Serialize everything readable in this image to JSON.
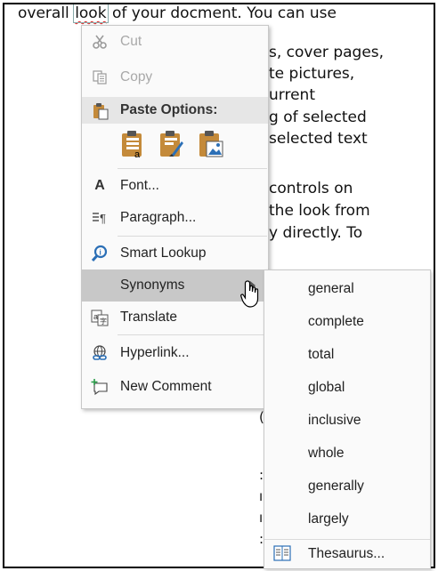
{
  "document": {
    "lines": [
      "overall look of your docment. You can use",
      "s, cover pages,",
      "te pictures,",
      "urrent",
      "g of selected",
      "selected text",
      "controls on",
      "the look from",
      "y directly. To"
    ],
    "selected_word": "look"
  },
  "context_menu": {
    "cut": "Cut",
    "copy": "Copy",
    "paste_options": "Paste Options:",
    "font": "Font...",
    "paragraph": "Paragraph...",
    "smart_lookup": "Smart Lookup",
    "synonyms": "Synonyms",
    "translate": "Translate",
    "hyperlink": "Hyperlink...",
    "new_comment": "New Comment"
  },
  "synonyms_menu": {
    "items": [
      "general",
      "complete",
      "total",
      "global",
      "inclusive",
      "whole",
      "generally",
      "largely"
    ],
    "thesaurus": "Thesaurus..."
  },
  "colors": {
    "hover": "#c8c8c8",
    "disabled_text": "#a8a8a8",
    "accent_blue": "#2b6fb6"
  }
}
